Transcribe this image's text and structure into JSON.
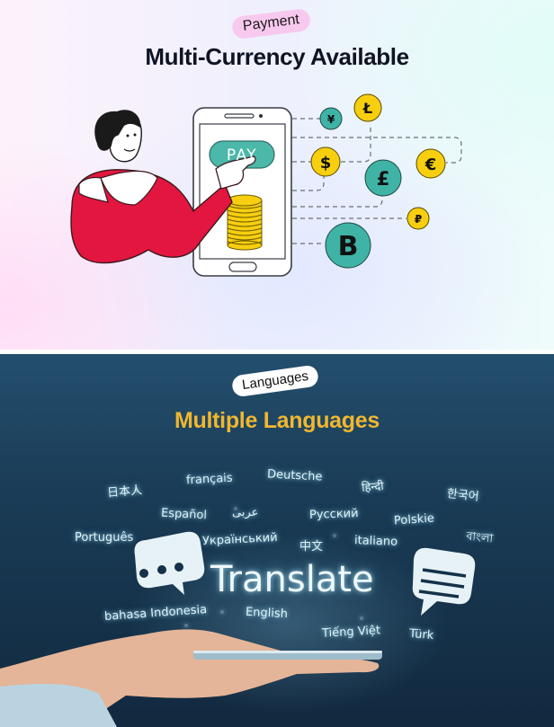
{
  "payment_section": {
    "badge": "Payment",
    "title": "Multi-Currency Available",
    "phone": {
      "button_label": "PAY"
    },
    "currencies": [
      {
        "name": "yen",
        "symbol": "¥",
        "color": "#3fb3a6"
      },
      {
        "name": "litecoin",
        "symbol": "Ł",
        "color": "#f7cf0f"
      },
      {
        "name": "dollar",
        "symbol": "$",
        "color": "#f7cf0f"
      },
      {
        "name": "euro",
        "symbol": "€",
        "color": "#f7cf0f"
      },
      {
        "name": "pound",
        "symbol": "£",
        "color": "#3fb3a6"
      },
      {
        "name": "ruble",
        "symbol": "₽",
        "color": "#f7cf0f"
      },
      {
        "name": "bitcoin",
        "symbol": "B",
        "color": "#3fb3a6"
      }
    ],
    "colors": {
      "sweater": "#e3163f",
      "coins": "#f7cf0f",
      "button": "#4cb8a9"
    }
  },
  "languages_section": {
    "badge": "Languages",
    "title": "Multiple Languages",
    "title_color": "#f0b72f",
    "center_word": "Translate",
    "languages": [
      "日本人",
      "français",
      "Deutsche",
      "हिन्दी",
      "한국어",
      "Español",
      "عربى",
      "Русский",
      "Polskie",
      "Português",
      "Український",
      "中文",
      "italiano",
      "বাংলা",
      "bahasa Indonesia",
      "English",
      "Tiếng Việt",
      "Türk"
    ]
  }
}
